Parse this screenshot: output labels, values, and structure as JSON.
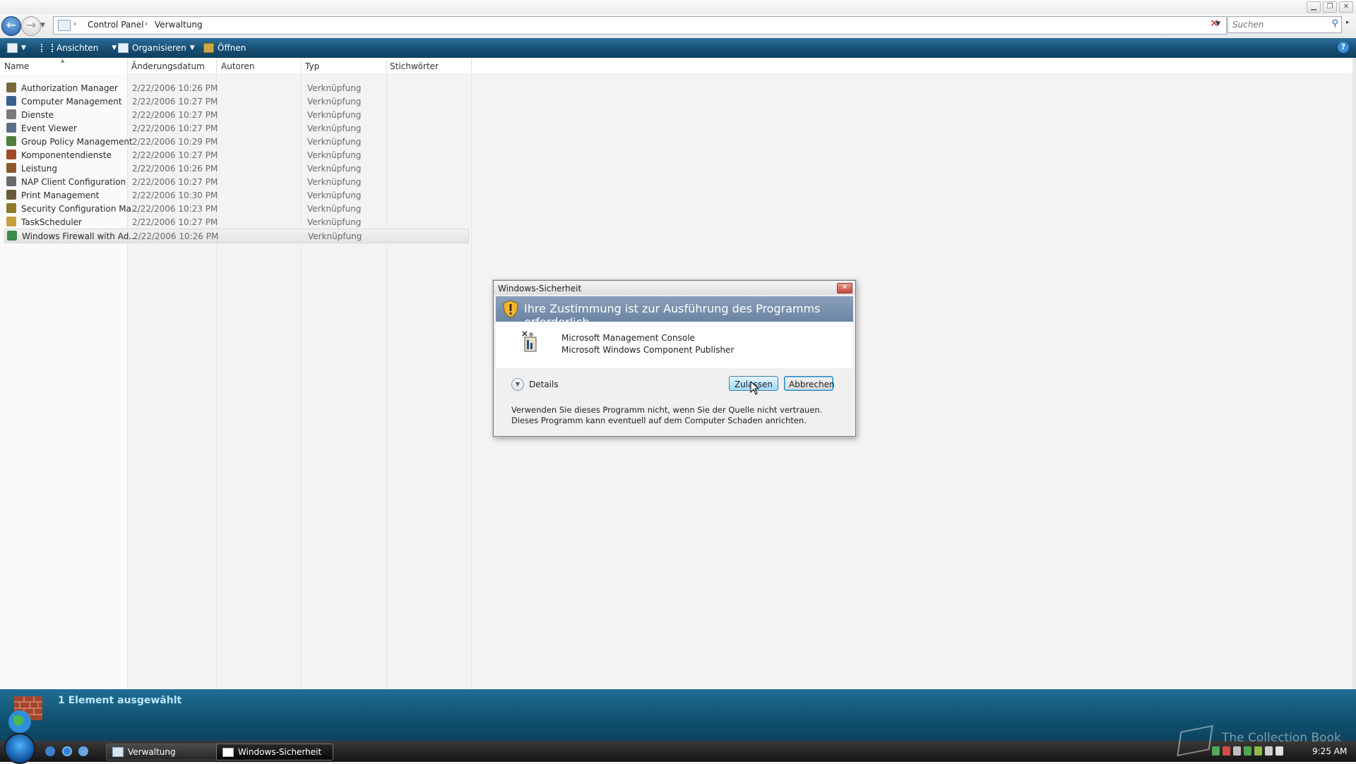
{
  "explorer": {
    "breadcrumb": [
      "Control Panel",
      "Verwaltung"
    ],
    "search_placeholder": "Suchen",
    "commands": {
      "views": "Ansichten",
      "organize": "Organisieren",
      "open": "Öffnen"
    },
    "columns": {
      "name": "Name",
      "date": "Änderungsdatum",
      "authors": "Autoren",
      "type": "Typ",
      "tags": "Stichwörter"
    },
    "files": [
      {
        "name": "Authorization Manager",
        "date": "2/22/2006 10:26 PM",
        "type": "Verknüpfung",
        "icon": "authorization-manager-icon",
        "color": "#7a6a3a"
      },
      {
        "name": "Computer Management",
        "date": "2/22/2006 10:27 PM",
        "type": "Verknüpfung",
        "icon": "computer-management-icon",
        "color": "#3a5f8f"
      },
      {
        "name": "Dienste",
        "date": "2/22/2006 10:27 PM",
        "type": "Verknüpfung",
        "icon": "services-icon",
        "color": "#7a7a7a"
      },
      {
        "name": "Event Viewer",
        "date": "2/22/2006 10:27 PM",
        "type": "Verknüpfung",
        "icon": "event-viewer-icon",
        "color": "#5a6f86"
      },
      {
        "name": "Group Policy Management",
        "date": "2/22/2006 10:29 PM",
        "type": "Verknüpfung",
        "icon": "group-policy-icon",
        "color": "#4f7f3a"
      },
      {
        "name": "Komponentendienste",
        "date": "2/22/2006 10:27 PM",
        "type": "Verknüpfung",
        "icon": "component-services-icon",
        "color": "#a04a2a"
      },
      {
        "name": "Leistung",
        "date": "2/22/2006 10:26 PM",
        "type": "Verknüpfung",
        "icon": "performance-icon",
        "color": "#8a5a2a"
      },
      {
        "name": "NAP Client Configuration",
        "date": "2/22/2006 10:27 PM",
        "type": "Verknüpfung",
        "icon": "nap-client-icon",
        "color": "#6a6a6a"
      },
      {
        "name": "Print Management",
        "date": "2/22/2006 10:30 PM",
        "type": "Verknüpfung",
        "icon": "print-management-icon",
        "color": "#6b5a3a"
      },
      {
        "name": "Security Configuration Ma...",
        "date": "2/22/2006 10:23 PM",
        "type": "Verknüpfung",
        "icon": "security-configuration-icon",
        "color": "#8f7a2a"
      },
      {
        "name": "TaskScheduler",
        "date": "2/22/2006 10:27 PM",
        "type": "Verknüpfung",
        "icon": "task-scheduler-icon",
        "color": "#c8a040"
      },
      {
        "name": "Windows Firewall with Ad...",
        "date": "2/22/2006 10:26 PM",
        "type": "Verknüpfung",
        "icon": "firewall-icon",
        "color": "#3a8a4a",
        "selected": true
      }
    ],
    "status": "1 Element ausgewählt"
  },
  "dialog": {
    "title": "Windows-Sicherheit",
    "heading": "Ihre Zustimmung ist zur Ausführung des Programms erforderlich",
    "program_name": "Microsoft Management Console",
    "publisher": "Microsoft Windows Component Publisher",
    "details_label": "Details",
    "allow_label": "Zulassen",
    "cancel_label": "Abbrechen",
    "warning": "Verwenden Sie dieses Programm nicht, wenn Sie der Quelle nicht vertrauen. Dieses Programm kann eventuell auf dem Computer Schaden anrichten."
  },
  "taskbar": {
    "tasks": [
      "Verwaltung",
      "Windows-Sicherheit"
    ],
    "clock": "9:25 AM",
    "watermark": "The Collection Book"
  },
  "colors": {
    "command_bar": "#164e73",
    "details_pane": "#10516f",
    "dialog_banner": "#7a92ae",
    "selection": "#e6e6e6"
  }
}
